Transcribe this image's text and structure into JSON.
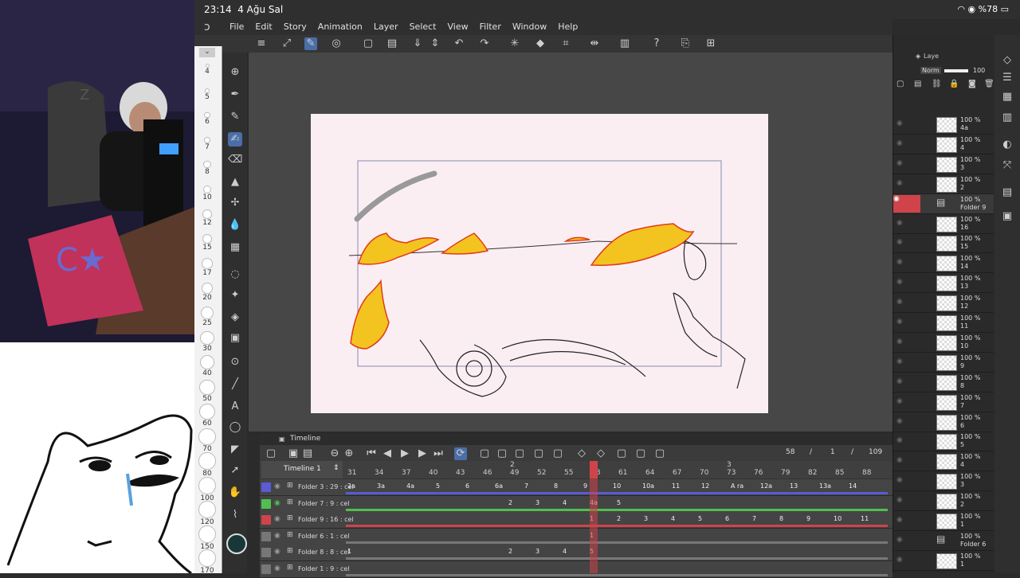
{
  "status_bar": {
    "time": "23:14",
    "date": "4 Ağu Sal",
    "battery": "%78"
  },
  "menu": [
    "File",
    "Edit",
    "Story",
    "Animation",
    "Layer",
    "Select",
    "View",
    "Filter",
    "Window",
    "Help"
  ],
  "brush_sizes": [
    "4",
    "5",
    "6",
    "7",
    "8",
    "10",
    "12",
    "15",
    "17",
    "20",
    "25",
    "30",
    "40",
    "50",
    "60",
    "70",
    "80",
    "100",
    "120",
    "150",
    "170"
  ],
  "timeline": {
    "title": "Timeline",
    "track_name": "Timeline 1",
    "current_frame": "58",
    "page": "1",
    "total": "109",
    "ruler": [
      "31",
      "34",
      "37",
      "40",
      "43",
      "46",
      "49",
      "52",
      "55",
      "58",
      "61",
      "64",
      "67",
      "70",
      "73",
      "76",
      "79",
      "82",
      "85",
      "88"
    ],
    "ruler_markers": [
      "2",
      "3"
    ],
    "rows": [
      {
        "name": "Folder 3 : 29 : cel",
        "color": "#5b5bd6",
        "cells": [
          "2a",
          "3a",
          "4a",
          "5",
          "6",
          "6a",
          "7",
          "8",
          "9",
          "10",
          "10a",
          "11",
          "12",
          "A ra",
          "12a",
          "13",
          "13a",
          "14"
        ]
      },
      {
        "name": "Folder 7 : 9 : cel",
        "color": "#4fbf4f",
        "cells": [
          "2",
          "3",
          "4",
          "4a",
          "5"
        ]
      },
      {
        "name": "Folder 9 : 16 : cel",
        "color": "#d0434b",
        "cells": [
          "1",
          "2",
          "3",
          "4",
          "5",
          "6",
          "7",
          "8",
          "9",
          "10",
          "11"
        ]
      },
      {
        "name": "Folder 6 : 1 : cel",
        "color": "#777777",
        "cells": [
          "1"
        ]
      },
      {
        "name": "Folder 8 : 8 : cel",
        "color": "#777777",
        "cells": [
          "1",
          "2",
          "3",
          "4",
          "5"
        ]
      },
      {
        "name": "Folder 1 : 9 : cel",
        "color": "#777777",
        "cells": []
      }
    ]
  },
  "layers_panel": {
    "tab_label": "Laye",
    "blend_mode": "Norm",
    "opacity": "100",
    "rows": [
      {
        "pct": "100 %",
        "name": "4a"
      },
      {
        "pct": "100 %",
        "name": "4"
      },
      {
        "pct": "100 %",
        "name": "3"
      },
      {
        "pct": "100 %",
        "name": "2"
      },
      {
        "pct": "100 %",
        "name": "Folder 9",
        "folder": true
      },
      {
        "pct": "100 %",
        "name": "16"
      },
      {
        "pct": "100 %",
        "name": "15"
      },
      {
        "pct": "100 %",
        "name": "14"
      },
      {
        "pct": "100 %",
        "name": "13"
      },
      {
        "pct": "100 %",
        "name": "12"
      },
      {
        "pct": "100 %",
        "name": "11"
      },
      {
        "pct": "100 %",
        "name": "10"
      },
      {
        "pct": "100 %",
        "name": "9"
      },
      {
        "pct": "100 %",
        "name": "8"
      },
      {
        "pct": "100 %",
        "name": "7"
      },
      {
        "pct": "100 %",
        "name": "6"
      },
      {
        "pct": "100 %",
        "name": "5"
      },
      {
        "pct": "100 %",
        "name": "4"
      },
      {
        "pct": "100 %",
        "name": "3"
      },
      {
        "pct": "100 %",
        "name": "2"
      },
      {
        "pct": "100 %",
        "name": "1"
      },
      {
        "pct": "100 %",
        "name": "Folder 6",
        "folder": true
      },
      {
        "pct": "100 %",
        "name": "1"
      }
    ]
  },
  "colors": {
    "accent": "#4a6ea8",
    "playhead": "#d0434b",
    "paper": "#fbeef3"
  }
}
